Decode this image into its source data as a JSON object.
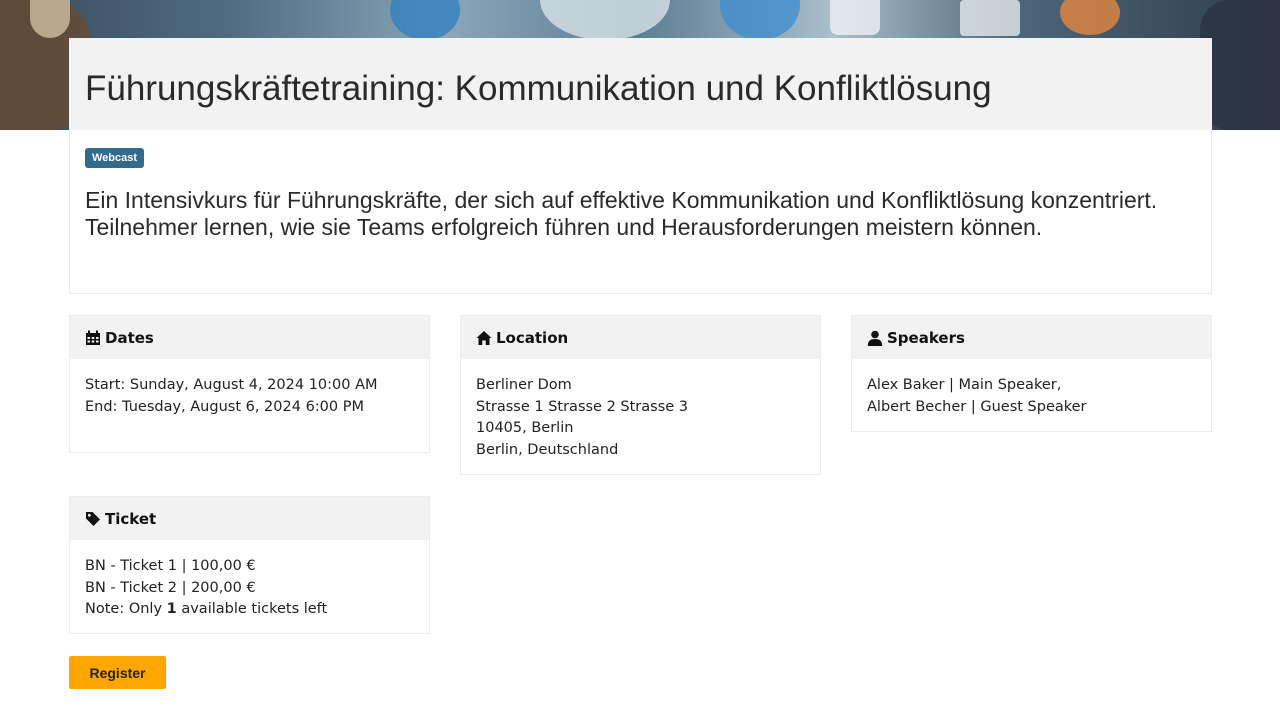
{
  "event": {
    "title": "Führungskräftetraining: Kommunikation und Konfliktlösung",
    "badge": "Webcast",
    "description": "Ein Intensivkurs für Führungskräfte, der sich auf effektive Kommunikation und Konfliktlösung konzentriert. Teilnehmer lernen, wie sie Teams erfolgreich führen und Herausforderungen meistern können."
  },
  "dates": {
    "heading": "Dates",
    "icon": "calendar-icon",
    "start": "Start: Sunday, August 4, 2024 10:00 AM",
    "end": "End: Tuesday, August 6, 2024 6:00 PM"
  },
  "location": {
    "heading": "Location",
    "icon": "home-icon",
    "lines": [
      "Berliner Dom",
      "Strasse 1 Strasse 2 Strasse 3",
      "10405, Berlin",
      "Berlin, Deutschland"
    ]
  },
  "speakers": {
    "heading": "Speakers",
    "icon": "user-icon",
    "items": [
      "Alex Baker | Main Speaker,",
      "Albert Becher | Guest Speaker"
    ]
  },
  "ticket": {
    "heading": "Ticket",
    "icon": "tag-icon",
    "items": [
      "BN - Ticket 1 | 100,00 €",
      "BN - Ticket 2 | 200,00 €"
    ],
    "note_prefix": "Note: Only ",
    "note_count": "1",
    "note_suffix": " available tickets left"
  },
  "actions": {
    "register_label": "Register"
  },
  "colors": {
    "badge": "#336b8f",
    "register_button": "#ffa500",
    "card_header": "#f2f2f2"
  }
}
